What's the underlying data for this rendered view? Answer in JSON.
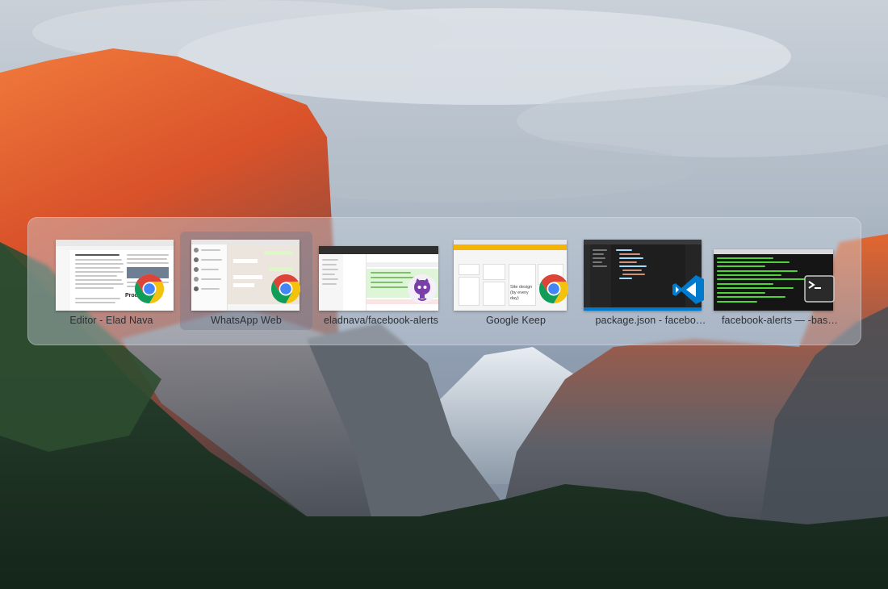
{
  "switcher": {
    "windows": [
      {
        "title": "Editor - Elad Nava",
        "app": "chrome-icon",
        "thumb_text": "Productivity"
      },
      {
        "title": "WhatsApp Web",
        "app": "chrome-icon",
        "selected": true
      },
      {
        "title": "eladnava/facebook-alerts",
        "app": "github-desktop-icon"
      },
      {
        "title": "Google Keep",
        "app": "chrome-icon",
        "thumb_text": "Site design (by every day)"
      },
      {
        "title": "package.json - facebo…",
        "app": "vscode-icon"
      },
      {
        "title": "facebook-alerts — -bas…",
        "app": "terminal-icon"
      }
    ]
  },
  "colors": {
    "selected_bg": "#6e788c",
    "chrome_red": "#db4437",
    "chrome_yellow": "#f4c20d",
    "chrome_green": "#0f9d58",
    "chrome_blue": "#4285f4",
    "vscode_blue": "#007acc",
    "github_purple": "#6e3aa8",
    "keep_yellow": "#f6b400",
    "terminal_bg": "#151515",
    "terminal_green": "#4fd23a"
  }
}
